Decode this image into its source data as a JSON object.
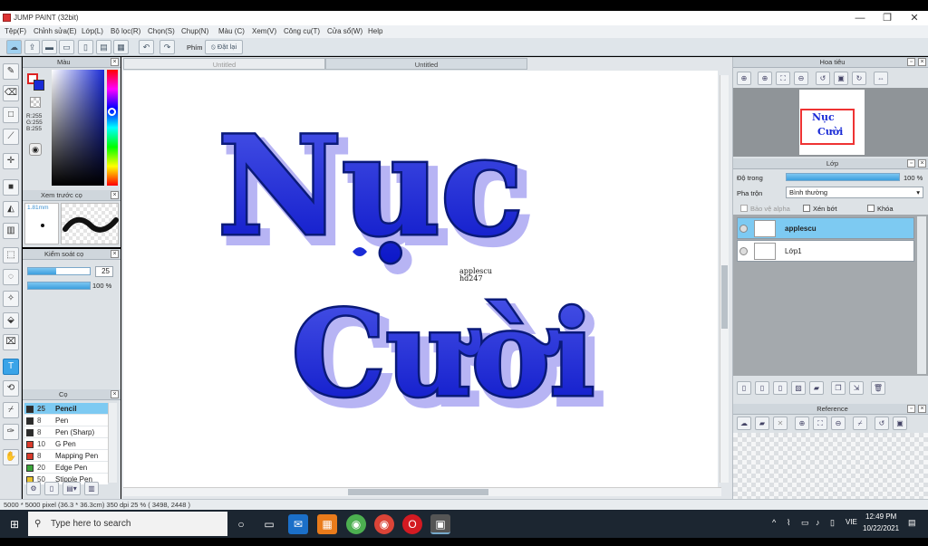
{
  "window": {
    "title": "JUMP PAINT (32bit)",
    "min": "—",
    "max": "❐",
    "close": "✕"
  },
  "menu": [
    "Tệp(F)",
    "Chỉnh sửa(E)",
    "Lớp(L)",
    "Bộ lọc(R)",
    "Chọn(S)",
    "Chụp(N)",
    "Màu (C)",
    "Xem(V)",
    "Công cụ(T)",
    "Cửa sổ(W)",
    "Help"
  ],
  "toolbar": {
    "key_label": "Phím",
    "reset_label": "Đặt lại"
  },
  "panels": {
    "color": {
      "title": "Màu",
      "r": "R:255",
      "g": "G:255",
      "b": "B:255"
    },
    "brush_preview": {
      "title": "Xem trước cọ",
      "size": "1.81mm"
    },
    "brush_control": {
      "title": "Kiểm soát cọ",
      "size_value": "25",
      "size_fraction": 0.45,
      "opacity_value": "100 %",
      "opacity_fraction": 1.0
    },
    "brush": {
      "title": "Cọ",
      "items": [
        {
          "size": "25",
          "name": "Pencil",
          "color": "#2b2b2b"
        },
        {
          "size": "8",
          "name": "Pen",
          "color": "#2b2b2b"
        },
        {
          "size": "8",
          "name": "Pen (Sharp)",
          "color": "#2b2b2b"
        },
        {
          "size": "10",
          "name": "G Pen",
          "color": "#d93a2b"
        },
        {
          "size": "8",
          "name": "Mapping Pen",
          "color": "#d93a2b"
        },
        {
          "size": "20",
          "name": "Edge Pen",
          "color": "#3aa63a"
        },
        {
          "size": "50",
          "name": "Stipple Pen",
          "color": "#e6c02a"
        }
      ]
    }
  },
  "tabs": [
    "Untitled",
    "Untitled"
  ],
  "canvas": {
    "line1": "Nục",
    "line2": "Cười",
    "signature_line1": "applescu",
    "signature_line2": "hd247"
  },
  "navigator": {
    "title": "Hoa tiêu",
    "thumb_line1": "Nục",
    "thumb_line2": "Cười"
  },
  "layer": {
    "title": "Lớp",
    "opacity_label": "Độ trong",
    "opacity_value": "100 %",
    "opacity_fraction": 1.0,
    "blend_label": "Pha trộn",
    "blend_value": "Bình thường",
    "protect_alpha": "Bảo vệ alpha",
    "clip": "Xén bớt",
    "lock": "Khóa",
    "layers": [
      {
        "name": "applescu",
        "selected": true
      },
      {
        "name": "Lớp1",
        "selected": false
      }
    ]
  },
  "reference": {
    "title": "Reference"
  },
  "status": {
    "text": "5000 * 5000 pixel  (36.3 * 36.3cm)  350 dpi  25 %  ( 3498, 2448 )"
  },
  "taskbar": {
    "search_placeholder": "Type here to search",
    "lang": "VIE",
    "time": "12:49 PM",
    "date": "10/22/2021"
  },
  "colors": {
    "accent": "#3aa4e8",
    "text_blue": "#1a2bd6",
    "text_outline": "#0a1a7a"
  }
}
